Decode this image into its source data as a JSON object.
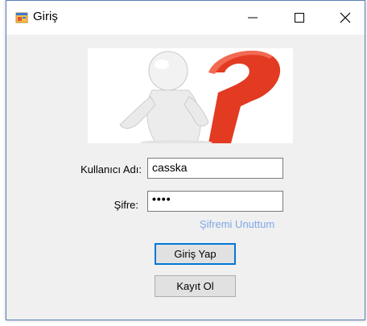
{
  "window": {
    "title": "Giriş",
    "accent": "#0078d7"
  },
  "form": {
    "username_label": "Kullanıcı Adı:",
    "username_value": "casska",
    "password_label": "Şifre:",
    "password_value": "••••",
    "forgot_link": "Şifremi Unuttum",
    "login_button": "Giriş Yap",
    "register_button": "Kayıt Ol"
  },
  "colors": {
    "link": "#7fa8e6",
    "question_mark": "#e33a22"
  }
}
